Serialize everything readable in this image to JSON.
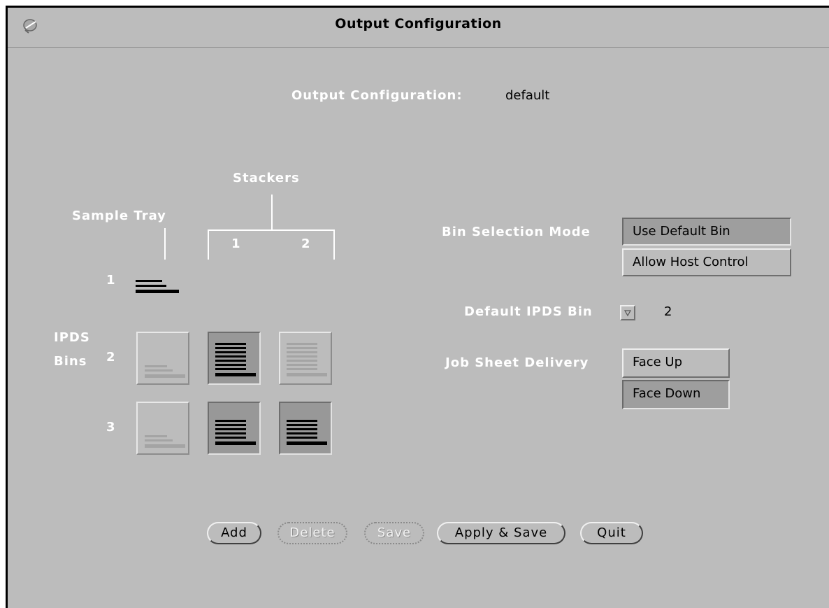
{
  "window": {
    "title": "Output Configuration",
    "menu_icon": "window-menu-icon"
  },
  "header": {
    "label": "Output Configuration:",
    "value": "default"
  },
  "diagram": {
    "stackers_label": "Stackers",
    "sample_tray_label": "Sample Tray",
    "stacker_numbers": [
      "1",
      "2"
    ],
    "row_numbers": [
      "1",
      "2",
      "3"
    ],
    "ipds_label_line1": "IPDS",
    "ipds_label_line2": "Bins",
    "bins": {
      "row2": [
        {
          "column": "Sample Tray",
          "state": "inactive"
        },
        {
          "column": "Stacker 1",
          "state": "active"
        },
        {
          "column": "Stacker 2",
          "state": "inactive"
        }
      ],
      "row3": [
        {
          "column": "Sample Tray",
          "state": "inactive"
        },
        {
          "column": "Stacker 1",
          "state": "active"
        },
        {
          "column": "Stacker 2",
          "state": "active"
        }
      ]
    }
  },
  "bin_selection": {
    "label": "Bin Selection Mode",
    "options": [
      "Use Default Bin",
      "Allow Host Control"
    ],
    "selected": "Use Default Bin"
  },
  "default_ipds_bin": {
    "label": "Default IPDS Bin",
    "value": "2",
    "icon": "menu-triangle-icon"
  },
  "job_sheet_delivery": {
    "label": "Job Sheet Delivery",
    "options": [
      "Face Up",
      "Face Down"
    ],
    "selected": "Face Down"
  },
  "buttons": {
    "add": "Add",
    "delete": "Delete",
    "save": "Save",
    "apply_save": "Apply & Save",
    "quit": "Quit"
  },
  "colors": {
    "panel_bg": "#bcbcbc",
    "label_text": "#ffffff",
    "active_bin_bg": "#989898",
    "stack_black": "#000000",
    "stack_dim": "#a4a4a4"
  }
}
